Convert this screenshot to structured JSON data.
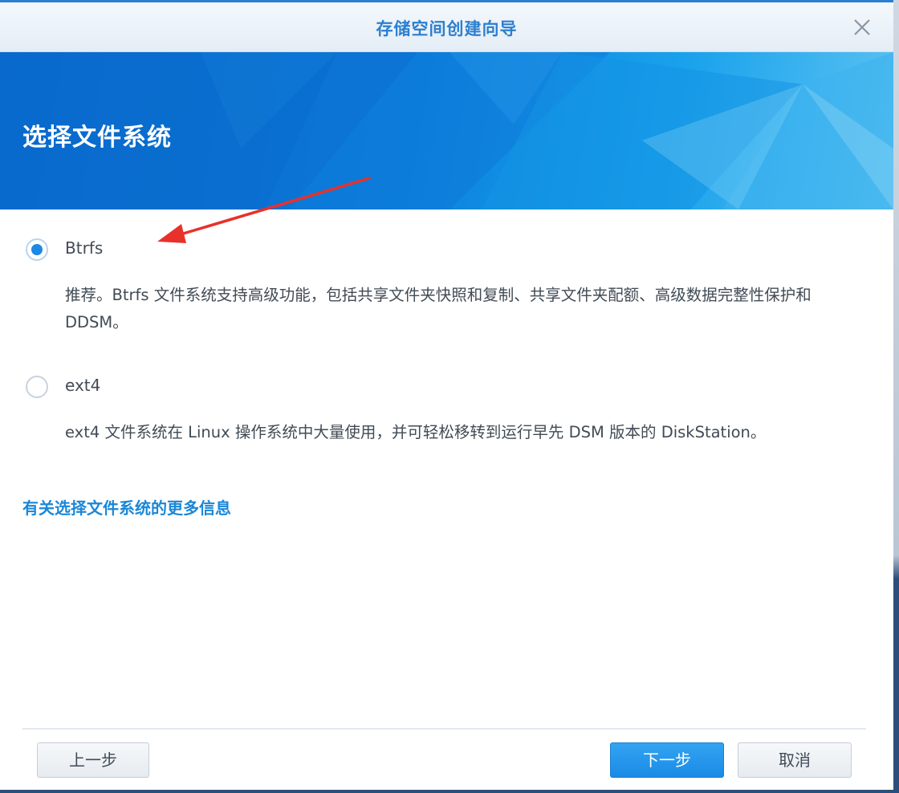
{
  "window": {
    "title": "存储空间创建向导"
  },
  "banner": {
    "heading": "选择文件系统"
  },
  "options": [
    {
      "label": "Btrfs",
      "description": "推荐。Btrfs 文件系统支持高级功能，包括共享文件夹快照和复制、共享文件夹配额、高级数据完整性保护和 DDSM。",
      "selected": true
    },
    {
      "label": "ext4",
      "description": "ext4 文件系统在 Linux 操作系统中大量使用，并可轻松移转到运行早先 DSM 版本的 DiskStation。",
      "selected": false
    }
  ],
  "more_info_link": "有关选择文件系统的更多信息",
  "footer": {
    "back_label": "上一步",
    "next_label": "下一步",
    "cancel_label": "取消"
  },
  "colors": {
    "accent": "#1e88e5",
    "link": "#1b87d8",
    "annotation_arrow": "#e8312a"
  },
  "icons": {
    "close": "close-icon",
    "annotation": "red-arrow-annotation"
  }
}
